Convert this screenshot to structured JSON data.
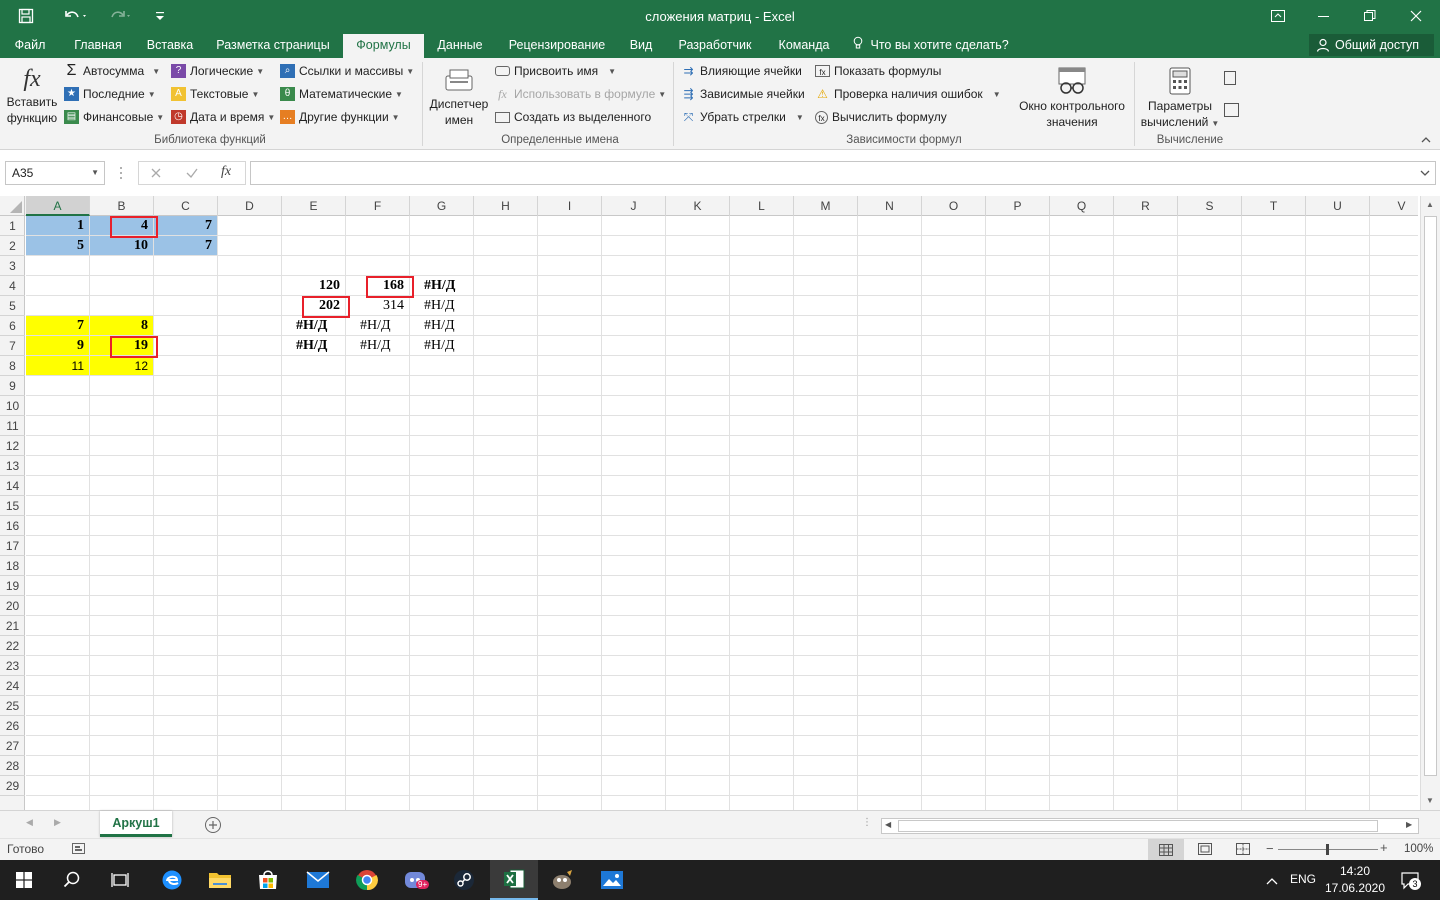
{
  "window": {
    "title": "сложения матриц - Excel"
  },
  "tabs": [
    {
      "label": "Файл"
    },
    {
      "label": "Главная"
    },
    {
      "label": "Вставка"
    },
    {
      "label": "Разметка страницы"
    },
    {
      "label": "Формулы"
    },
    {
      "label": "Данные"
    },
    {
      "label": "Рецензирование"
    },
    {
      "label": "Вид"
    },
    {
      "label": "Разработчик"
    },
    {
      "label": "Команда"
    }
  ],
  "tell_me": "Что вы хотите сделать?",
  "share": "Общий доступ",
  "ribbon": {
    "insert_function": [
      "Вставить",
      "функцию"
    ],
    "library": {
      "autosum": "Автосумма",
      "recent": "Последние",
      "financial": "Финансовые",
      "logical": "Логические",
      "text": "Текстовые",
      "datetime": "Дата и время",
      "lookup": "Ссылки и массивы",
      "math": "Математические",
      "other": "Другие функции",
      "group_label": "Библиотека функций"
    },
    "names": {
      "manager": [
        "Диспетчер",
        "имен"
      ],
      "define": "Присвоить имя",
      "use_in_formula": "Использовать в формуле",
      "create_from_selection": "Создать из выделенного",
      "group_label": "Определенные имена"
    },
    "auditing": {
      "trace_precedents": "Влияющие ячейки",
      "trace_dependents": "Зависимые ячейки",
      "remove_arrows": "Убрать стрелки",
      "show_formulas": "Показать формулы",
      "error_checking": "Проверка наличия ошибок",
      "evaluate": "Вычислить формулу",
      "watch_window": [
        "Окно контрольного",
        "значения"
      ],
      "group_label": "Зависимости формул"
    },
    "calculation": {
      "options": [
        "Параметры",
        "вычислений"
      ],
      "group_label": "Вычисление"
    }
  },
  "formula_bar": {
    "name_box": "A35",
    "formula": ""
  },
  "columns": [
    "A",
    "B",
    "C",
    "D",
    "E",
    "F",
    "G",
    "H",
    "I",
    "J",
    "K",
    "L",
    "M",
    "N",
    "O",
    "P",
    "Q",
    "R",
    "S",
    "T",
    "U",
    "V"
  ],
  "rows": [
    "1",
    "2",
    "3",
    "4",
    "5",
    "6",
    "7",
    "8",
    "9",
    "10",
    "11",
    "12",
    "13",
    "14",
    "15",
    "16",
    "17",
    "18",
    "19",
    "20",
    "21",
    "22",
    "23",
    "24",
    "25",
    "26",
    "27",
    "28",
    "29"
  ],
  "cells": [
    {
      "ref": "A1",
      "value": "1"
    },
    {
      "ref": "B1",
      "value": "4"
    },
    {
      "ref": "C1",
      "value": "7"
    },
    {
      "ref": "A2",
      "value": "5"
    },
    {
      "ref": "B2",
      "value": "10"
    },
    {
      "ref": "C2",
      "value": "7"
    },
    {
      "ref": "E4",
      "value": "120"
    },
    {
      "ref": "F4",
      "value": "168"
    },
    {
      "ref": "G4",
      "value": "#Н/Д"
    },
    {
      "ref": "E5",
      "value": "202"
    },
    {
      "ref": "F5",
      "value": "314"
    },
    {
      "ref": "G5",
      "value": "#Н/Д"
    },
    {
      "ref": "E6",
      "value": "#Н/Д"
    },
    {
      "ref": "F6",
      "value": "#Н/Д"
    },
    {
      "ref": "G6",
      "value": "#Н/Д"
    },
    {
      "ref": "E7",
      "value": "#Н/Д"
    },
    {
      "ref": "F7",
      "value": "#Н/Д"
    },
    {
      "ref": "G7",
      "value": "#Н/Д"
    },
    {
      "ref": "A6",
      "value": "7"
    },
    {
      "ref": "B6",
      "value": "8"
    },
    {
      "ref": "A7",
      "value": "9"
    },
    {
      "ref": "B7",
      "value": "19"
    },
    {
      "ref": "A8",
      "value": "11"
    },
    {
      "ref": "B8",
      "value": "12"
    }
  ],
  "colors": {
    "accent": "#217346",
    "blue_fill": "#9bc2e6",
    "yellow_fill": "#ffff00",
    "highlight_border": "#e8202a"
  },
  "sheet_tab": "Аркуш1",
  "status": {
    "text": "Готово",
    "zoom": "100%"
  },
  "taskbar": {
    "lang": "ENG",
    "time": "14:20",
    "date": "17.06.2020",
    "notifications": "3",
    "discord_badge": "9+"
  }
}
